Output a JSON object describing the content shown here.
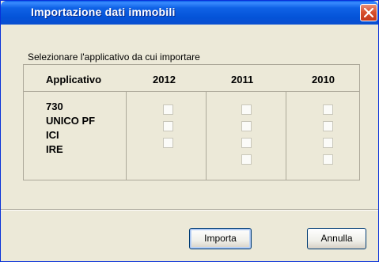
{
  "window": {
    "title": "Importazione dati immobili"
  },
  "section": {
    "label": "Selezionare l'applicativo da cui importare"
  },
  "table": {
    "headers": [
      "Applicativo",
      "2012",
      "2011",
      "2010"
    ],
    "rows": [
      "730",
      "UNICO PF",
      "ICI",
      "IRE"
    ]
  },
  "buttons": {
    "import": "Importa",
    "cancel": "Annulla"
  },
  "icons": {
    "close": "close-icon"
  },
  "colors": {
    "titlebar": "#0453d8",
    "close": "#d9512f",
    "window_bg": "#ece9d8"
  }
}
